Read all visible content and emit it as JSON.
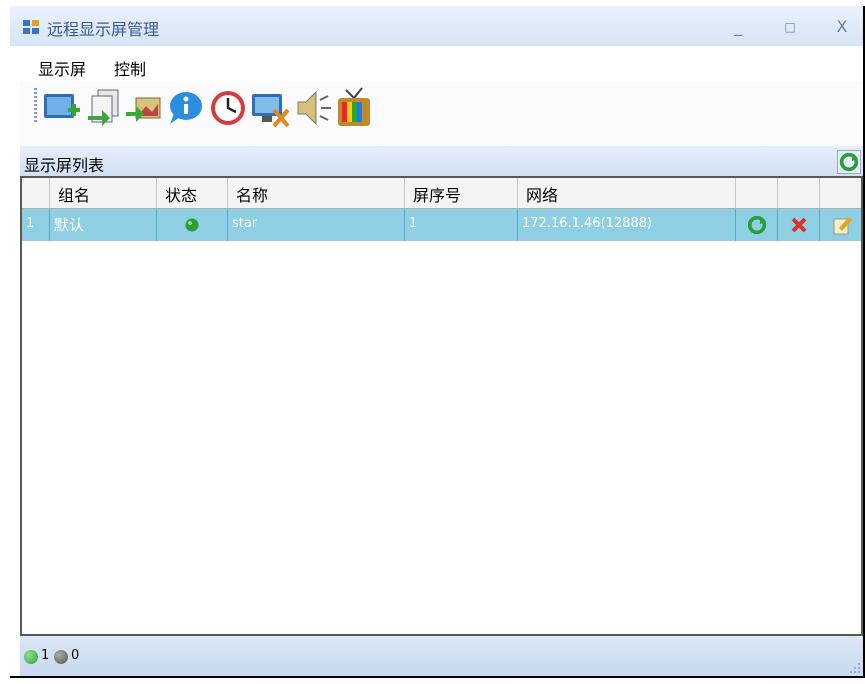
{
  "window": {
    "title": "远程显示屏管理",
    "minimize": "_",
    "maximize": "□",
    "close": "X"
  },
  "menu": {
    "items": [
      "显示屏",
      "控制"
    ]
  },
  "toolbar": {
    "buttons": [
      "add-screen-icon",
      "copy-document-icon",
      "send-image-icon",
      "info-bubble-icon",
      "clock-icon",
      "monitor-tools-icon",
      "speaker-icon",
      "tv-icon"
    ]
  },
  "list": {
    "title": "显示屏列表",
    "columns": [
      "",
      "组名",
      "状态",
      "名称",
      "屏序号",
      "网络",
      "",
      "",
      ""
    ],
    "rows": [
      {
        "index": "1",
        "group": "默认",
        "status": "online",
        "name": "star",
        "screen_no": "1",
        "network": "172.16.1.46(12888)"
      }
    ]
  },
  "status": {
    "online_count": "1",
    "offline_count": "0"
  },
  "colors": {
    "accent": "#3a5a8a",
    "selected_row": "#8fcfe4",
    "online": "#2e9e2e",
    "offline": "#555555"
  }
}
